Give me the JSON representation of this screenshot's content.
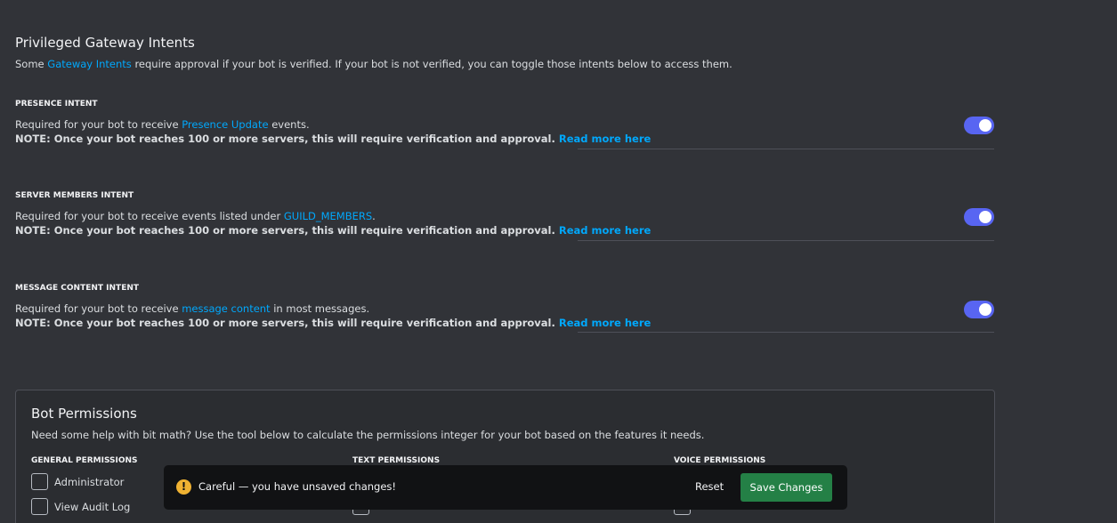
{
  "header": {
    "title": "Privileged Gateway Intents",
    "desc_pre": "Some ",
    "desc_link": "Gateway Intents",
    "desc_post": " require approval if your bot is verified. If your bot is not verified, you can toggle those intents below to access them."
  },
  "intents": [
    {
      "title": "PRESENCE INTENT",
      "line_pre": "Required for your bot to receive ",
      "line_link": "Presence Update",
      "line_post": " events.",
      "note": "NOTE: Once your bot reaches 100 or more servers, this will require verification and approval.",
      "note_link": "Read more here",
      "enabled": true
    },
    {
      "title": "SERVER MEMBERS INTENT",
      "line_pre": "Required for your bot to receive events listed under ",
      "line_link": "GUILD_MEMBERS",
      "line_post": ".",
      "note": "NOTE: Once your bot reaches 100 or more servers, this will require verification and approval.",
      "note_link": "Read more here",
      "enabled": true
    },
    {
      "title": "MESSAGE CONTENT INTENT",
      "line_pre": "Required for your bot to receive ",
      "line_link": "message content",
      "line_post": " in most messages.",
      "note": "NOTE: Once your bot reaches 100 or more servers, this will require verification and approval.",
      "note_link": "Read more here",
      "enabled": true
    }
  ],
  "permissions": {
    "title": "Bot Permissions",
    "desc": "Need some help with bit math? Use the tool below to calculate the permissions integer for your bot based on the features it needs.",
    "columns": [
      "GENERAL PERMISSIONS",
      "TEXT PERMISSIONS",
      "VOICE PERMISSIONS"
    ],
    "general": [
      "Administrator",
      "View Audit Log"
    ]
  },
  "notice": {
    "message": "Careful — you have unsaved changes!",
    "reset_label": "Reset",
    "save_label": "Save Changes",
    "icon": "!"
  },
  "colors": {
    "background": "#313338",
    "link": "#00a8fc",
    "toggle_on": "#5865f2",
    "save_button": "#248046",
    "warning": "#f0b232"
  }
}
